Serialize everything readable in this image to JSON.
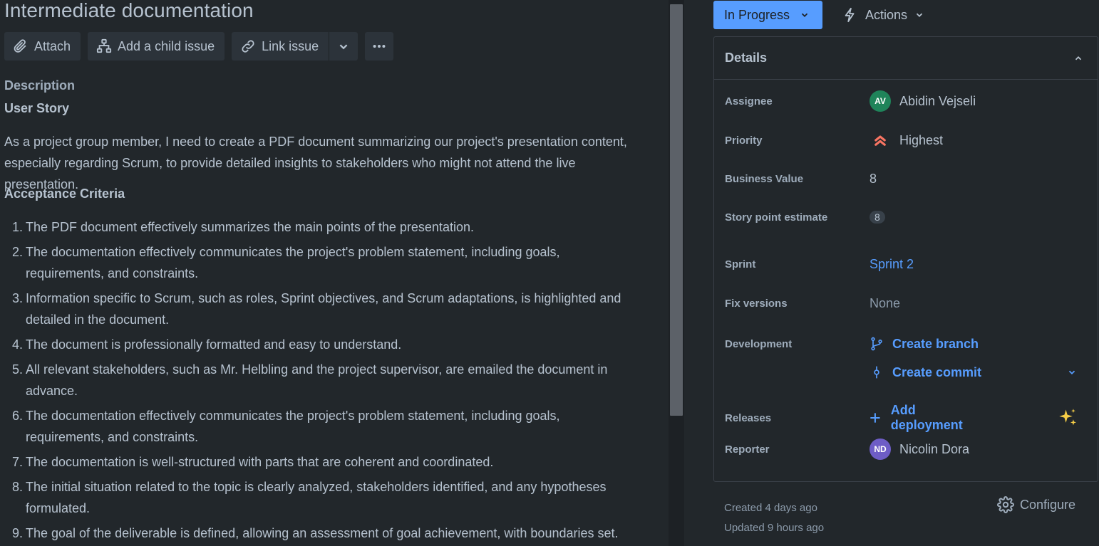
{
  "issue": {
    "title": "Intermediate documentation"
  },
  "toolbar": {
    "attach": "Attach",
    "add_child": "Add a child issue",
    "link_issue": "Link issue"
  },
  "description": {
    "label": "Description",
    "story_heading": "User Story",
    "story_text": "As a project group member, I need to create a PDF document summarizing our project's presentation content, especially regarding Scrum, to provide detailed insights to stakeholders who might not attend the live presentation.",
    "acceptance_heading": "Acceptance Criteria",
    "criteria": [
      {
        "num": "1.",
        "text": "The PDF document effectively summarizes the main points of the presentation."
      },
      {
        "num": "2.",
        "text": "The documentation effectively communicates the project's problem statement, including goals, requirements, and constraints."
      },
      {
        "num": "3.",
        "text": "Information specific to Scrum, such as roles, Sprint objectives, and Scrum adaptations, is highlighted and detailed in the document."
      },
      {
        "num": "4.",
        "text": "The document is professionally formatted and easy to understand."
      },
      {
        "num": "5.",
        "text": "All relevant stakeholders, such as Mr. Helbling and the project supervisor, are emailed the document in advance."
      },
      {
        "num": "6.",
        "text": "The documentation effectively communicates the project's problem statement, including goals, requirements, and constraints."
      },
      {
        "num": "7.",
        "text": "The documentation is well-structured with parts that are coherent and coordinated."
      },
      {
        "num": "8.",
        "text": "The initial situation related to the topic is clearly analyzed, stakeholders identified, and any hypotheses formulated."
      },
      {
        "num": "9.",
        "text": "The goal of the deliverable is defined, allowing an assessment of goal achievement, with boundaries set."
      }
    ]
  },
  "header_actions": {
    "status": "In Progress",
    "actions": "Actions"
  },
  "details": {
    "title": "Details",
    "assignee": {
      "label": "Assignee",
      "initials": "AV",
      "name": "Abidin Vejseli",
      "color": "#1f845a"
    },
    "priority": {
      "label": "Priority",
      "value": "Highest",
      "color": "#f87462"
    },
    "business_value": {
      "label": "Business Value",
      "value": "8"
    },
    "story_points": {
      "label": "Story point estimate",
      "value": "8"
    },
    "sprint": {
      "label": "Sprint",
      "value": "Sprint 2"
    },
    "fix_versions": {
      "label": "Fix versions",
      "value": "None"
    },
    "development": {
      "label": "Development",
      "create_branch": "Create branch",
      "create_commit": "Create commit"
    },
    "releases": {
      "label": "Releases",
      "add_deployment": "Add deployment"
    },
    "reporter": {
      "label": "Reporter",
      "initials": "ND",
      "name": "Nicolin Dora",
      "color": "#6e5dc6"
    }
  },
  "meta": {
    "created": "Created 4 days ago",
    "updated": "Updated 9 hours ago",
    "configure": "Configure"
  },
  "colors": {
    "accent": "#579dff",
    "background": "#22272b",
    "sparkle": "#f5cd47"
  }
}
